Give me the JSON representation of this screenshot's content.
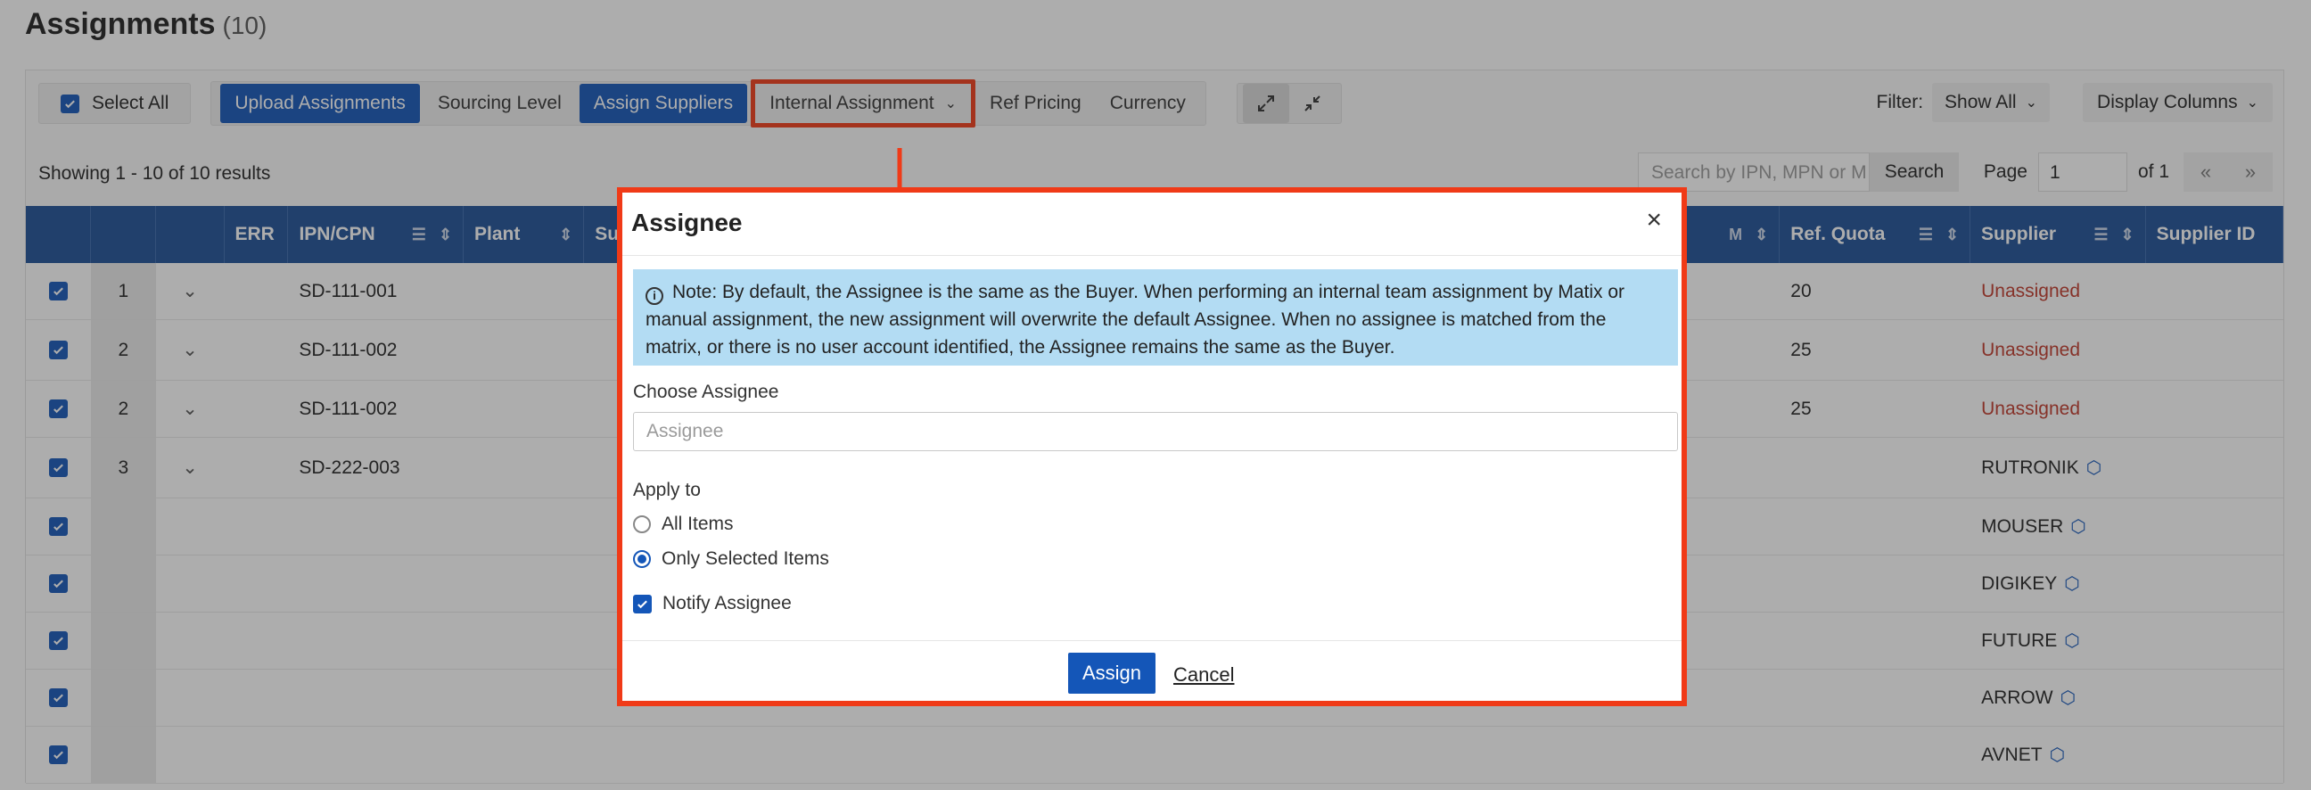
{
  "page": {
    "title": "Assignments",
    "count": "(10)"
  },
  "toolbar": {
    "select_all": "Select All",
    "upload": "Upload Assignments",
    "sourcing_level": "Sourcing Level",
    "assign_suppliers": "Assign Suppliers",
    "internal_assignment": "Internal Assignment",
    "ref_pricing": "Ref Pricing",
    "currency": "Currency",
    "filter_label": "Filter:",
    "filter_value": "Show All",
    "display_columns": "Display Columns",
    "expand_icon": "expand-icon",
    "collapse_icon": "collapse-icon"
  },
  "results": {
    "showing": "Showing 1 - 10 of 10 results",
    "search_placeholder": "Search by IPN, MPN or M",
    "search_button": "Search",
    "page_label": "Page",
    "page_value": "1",
    "page_of": "of 1",
    "first": "«",
    "prev": "»"
  },
  "table": {
    "headers": {
      "err": "ERR",
      "ipn": "IPN/CPN",
      "plant": "Plant",
      "su": "Su",
      "m": "M",
      "quota": "Ref. Quota",
      "supplier": "Supplier",
      "supplier_id": "Supplier ID"
    },
    "rows": [
      {
        "num": "1",
        "ipn": "SD-111-001",
        "quota": "20",
        "supplier": "Unassigned"
      },
      {
        "num": "2",
        "ipn": "SD-111-002",
        "quota": "25",
        "supplier": "Unassigned"
      },
      {
        "num": "2",
        "ipn": "SD-111-002",
        "quota": "25",
        "supplier": "Unassigned"
      },
      {
        "num": "3",
        "ipn": "SD-222-003",
        "quota": "",
        "supplier": "RUTRONIK"
      },
      {
        "num": "",
        "ipn": "",
        "quota": "",
        "supplier": "MOUSER"
      },
      {
        "num": "",
        "ipn": "",
        "quota": "",
        "supplier": "DIGIKEY"
      },
      {
        "num": "",
        "ipn": "",
        "quota": "",
        "supplier": "FUTURE"
      },
      {
        "num": "",
        "ipn": "",
        "quota": "",
        "supplier": "ARROW"
      },
      {
        "num": "",
        "ipn": "",
        "quota": "",
        "supplier": "AVNET"
      }
    ]
  },
  "modal": {
    "title": "Assignee",
    "close": "×",
    "note": "Note: By default, the Assignee is the same as the Buyer. When performing an internal team assignment by Matix or manual assignment, the new assignment will overwrite the default Assignee. When no assignee is matched from the matrix, or there is no user account identified, the Assignee remains the same as the Buyer.",
    "choose_label": "Choose Assignee",
    "assignee_placeholder": "Assignee",
    "apply_to": "Apply to",
    "option_all": "All Items",
    "option_selected": "Only Selected Items",
    "notify": "Notify Assignee",
    "assign": "Assign",
    "cancel": "Cancel"
  },
  "colors": {
    "primary": "#1456b8",
    "header": "#1d4f96",
    "highlight": "#f03a17",
    "note_bg": "#b3dcf3",
    "unassigned": "#c0392b"
  }
}
